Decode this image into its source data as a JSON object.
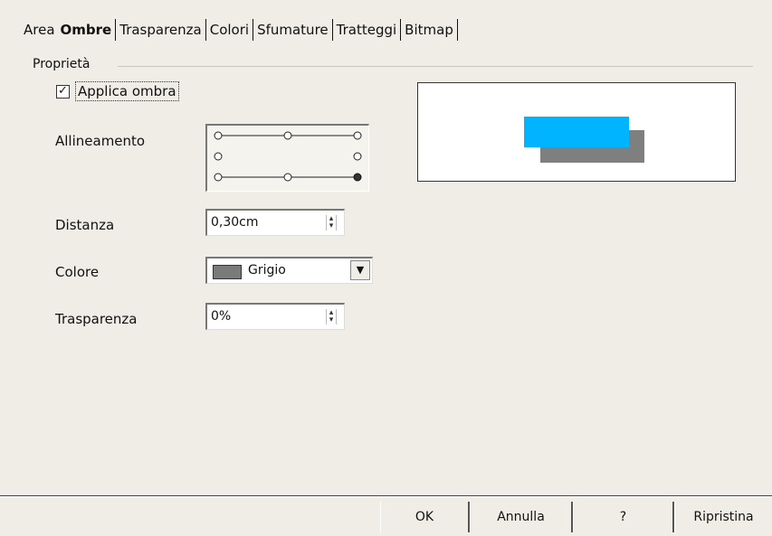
{
  "tabs": [
    {
      "label": "Area",
      "active": false
    },
    {
      "label": "Ombre",
      "active": true
    },
    {
      "label": "Trasparenza",
      "active": false
    },
    {
      "label": "Colori",
      "active": false
    },
    {
      "label": "Sfumature",
      "active": false
    },
    {
      "label": "Tratteggi",
      "active": false
    },
    {
      "label": "Bitmap",
      "active": false
    }
  ],
  "properties": {
    "group_title": "Proprietà",
    "apply_shadow": {
      "label": "Applica ombra",
      "checked": true,
      "check_glyph": "☑"
    },
    "alignment_label": "Allineamento",
    "distance": {
      "label": "Distanza",
      "value": "0,30cm"
    },
    "color": {
      "label": "Colore",
      "value": "Grigio",
      "swatch": "#7a7a7a"
    },
    "transparency": {
      "label": "Trasparenza",
      "value": "0%"
    }
  },
  "preview": {
    "object_color": "#00b4ff",
    "shadow_color": "#7f7f7f"
  },
  "buttons": {
    "ok": "OK",
    "cancel": "Annulla",
    "help": "?",
    "reset": "Ripristina"
  }
}
